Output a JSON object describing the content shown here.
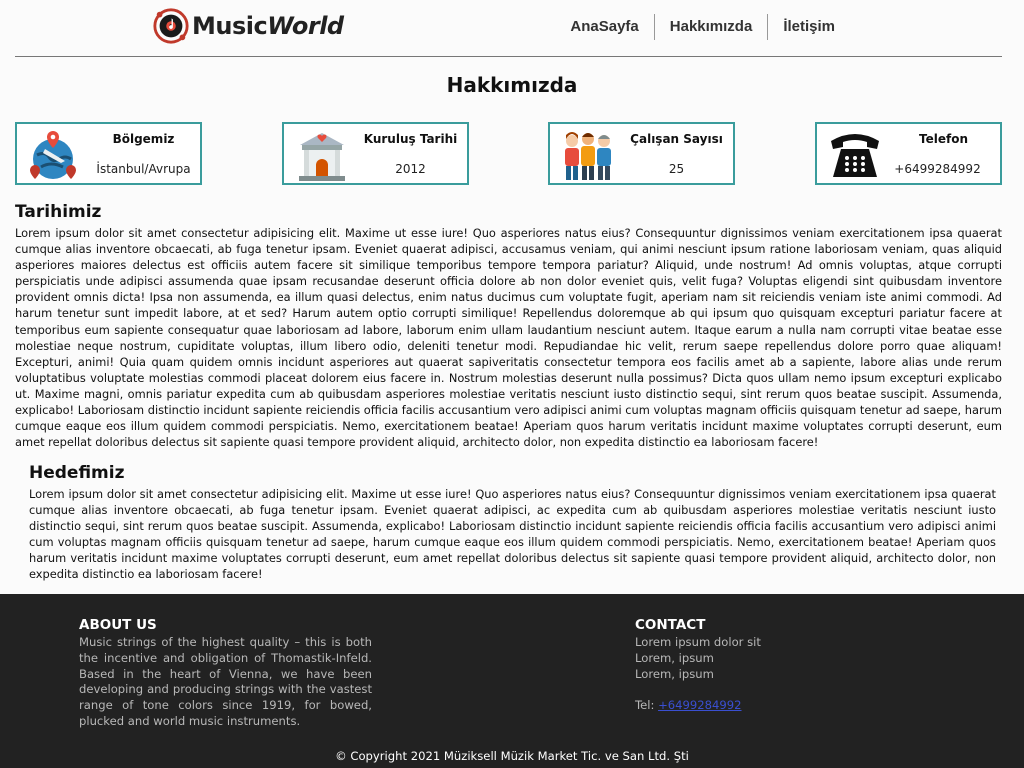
{
  "header": {
    "logo": {
      "icon": "music-disc-logo",
      "text_a": "Music",
      "text_b": "World"
    },
    "nav": [
      {
        "label": "AnaSayfa"
      },
      {
        "label": "Hakkımızda"
      },
      {
        "label": "İletişim"
      }
    ]
  },
  "page_title": "Hakkımızda",
  "cards": [
    {
      "title": "Bölgemiz",
      "value": "İstanbul/Avrupa",
      "icon": "globe-pins-icon"
    },
    {
      "title": "Kuruluş Tarihi",
      "value": "2012",
      "icon": "building-heart-icon"
    },
    {
      "title": "Çalışan Sayısı",
      "value": "25",
      "icon": "employees-icon"
    },
    {
      "title": "Telefon",
      "value": "+6499284992",
      "icon": "telephone-icon"
    }
  ],
  "history": {
    "title": "Tarihimiz",
    "body": "Lorem ipsum dolor sit amet consectetur adipisicing elit. Maxime ut esse iure! Quo asperiores natus eius? Consequuntur dignissimos veniam exercitationem ipsa quaerat cumque alias inventore obcaecati, ab fuga tenetur ipsam. Eveniet quaerat adipisci, accusamus veniam, qui animi nesciunt ipsum ratione laboriosam veniam, quas aliquid asperiores maiores delectus est officiis autem facere sit similique temporibus tempore tempora pariatur? Aliquid, unde nostrum! Ad omnis voluptas, atque corrupti perspiciatis unde adipisci assumenda quae ipsam recusandae deserunt officia dolore ab non dolor eveniet quis, velit fuga? Voluptas eligendi sint quibusdam inventore provident omnis dicta! Ipsa non assumenda, ea illum quasi delectus, enim natus ducimus cum voluptate fugit, aperiam nam sit reiciendis veniam iste animi commodi. Ad harum tenetur sunt impedit labore, at et sed? Harum autem optio corrupti similique! Repellendus doloremque ab qui ipsum quo quisquam excepturi pariatur facere at temporibus eum sapiente consequatur quae laboriosam ad labore, laborum enim ullam laudantium nesciunt autem. Itaque earum a nulla nam corrupti vitae beatae esse molestiae neque nostrum, cupiditate voluptas, illum libero odio, deleniti tenetur modi. Repudiandae hic velit, rerum saepe repellendus dolore porro quae aliquam! Excepturi, animi! Quia quam quidem omnis incidunt asperiores aut quaerat sapiveritatis consectetur tempora eos facilis amet ab a sapiente, labore alias unde rerum voluptatibus voluptate molestias commodi placeat dolorem eius facere in. Nostrum molestias deserunt nulla possimus? Dicta quos ullam nemo ipsum excepturi explicabo ut. Maxime magni, omnis pariatur expedita cum ab quibusdam asperiores molestiae veritatis nesciunt iusto distinctio sequi, sint rerum quos beatae suscipit. Assumenda, explicabo! Laboriosam distinctio incidunt sapiente reiciendis officia facilis accusantium vero adipisci animi cum voluptas magnam officiis quisquam tenetur ad saepe, harum cumque eaque eos illum quidem commodi perspiciatis. Nemo, exercitationem beatae! Aperiam quos harum veritatis incidunt maxime voluptates corrupti deserunt, eum amet repellat doloribus delectus sit sapiente quasi tempore provident aliquid, architecto dolor, non expedita distinctio ea laboriosam facere!"
  },
  "goal": {
    "title": "Hedefimiz",
    "body": "Lorem ipsum dolor sit amet consectetur adipisicing elit. Maxime ut esse iure! Quo asperiores natus eius? Consequuntur dignissimos veniam exercitationem ipsa quaerat cumque alias inventore obcaecati, ab fuga tenetur ipsam. Eveniet quaerat adipisci, ac expedita cum ab quibusdam asperiores molestiae veritatis nesciunt iusto distinctio sequi, sint rerum quos beatae suscipit. Assumenda, explicabo! Laboriosam distinctio incidunt sapiente reiciendis officia facilis accusantium vero adipisci animi cum voluptas magnam officiis quisquam tenetur ad saepe, harum cumque eaque eos illum quidem commodi perspiciatis. Nemo, exercitationem beatae! Aperiam quos harum veritatis incidunt maxime voluptates corrupti deserunt, eum amet repellat doloribus delectus sit sapiente quasi tempore provident aliquid, architecto dolor, non expedita distinctio ea laboriosam facere!"
  },
  "footer": {
    "about": {
      "title": "ABOUT US",
      "body": "Music strings of the highest quality – this is both the incentive and obligation of Thomastik-Infeld. Based in the heart of Vienna, we have been developing and producing strings with the vastest range of tone colors since 1919, for bowed, plucked and world music instruments."
    },
    "contact": {
      "title": "CONTACT",
      "lines": [
        "Lorem ipsum dolor sit",
        "Lorem, ipsum",
        "Lorem, ipsum"
      ],
      "tel_label": "Tel:",
      "tel_value": "+6499284992"
    },
    "copyright": "© Copyright 2021 Müziksell Müzik Market Tic. ve San Ltd. Şti"
  },
  "colors": {
    "card_border": "#3a9c9c",
    "footer_bg": "#222222",
    "link": "#3a4fd0"
  }
}
